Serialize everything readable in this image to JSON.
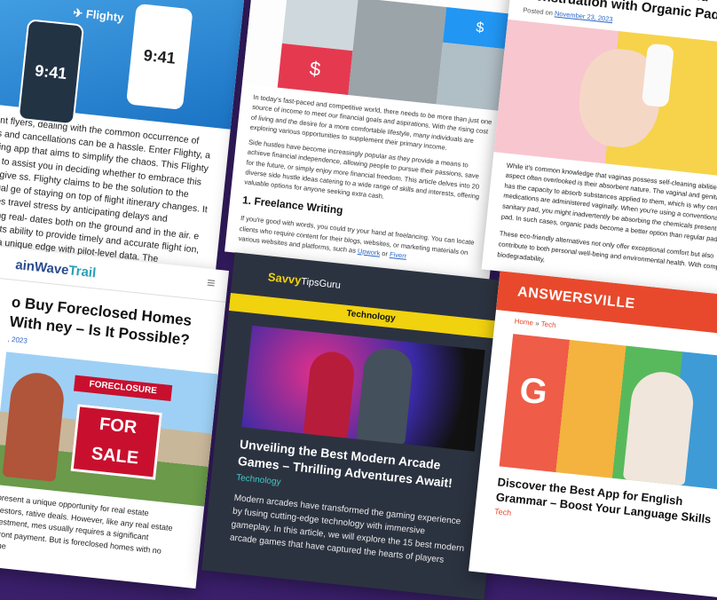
{
  "flighty": {
    "logo": "✈ Flighty",
    "phone_time": "9:41",
    "phone_time_2": "9:41",
    "body": "requent flyers, dealing with the common occurrence of flight s and cancellations can be a hassle. Enter Flighty, a flight- ing app that aims to simplify the chaos. This Flighty review to assist you in deciding whether to embrace this app or give ss. Flighty claims to be the solution to the perpetual ge of staying on top of flight itinerary changes. It promises travel stress by anticipating delays and delivering real- dates both on the ground and in the air. e asserts its ability to provide timely and accurate flight ion, offering a unique edge with pilot-level data. The"
  },
  "side_hustle": {
    "intro": "In today's fast-paced and competitive world, there needs to be more than just one source of income to meet our financial goals and aspirations. With the rising cost of living and the desire for a more comfortable lifestyle, many individuals are exploring various opportunities to supplement their primary income.",
    "para2": "Side hustles have become increasingly popular as they provide a means to achieve financial independence, allowing people to pursue their passions, save for the future, or simply enjoy more financial freedom. This article delves into 20 diverse side hustle ideas catering to a wide range of skills and interests, offering valuable options for anyone seeking extra cash.",
    "heading": "1. Freelance Writing",
    "para3": "If you're good with words, you could try your hand at freelancing. You can locate clients who require content for their blogs, websites, or marketing materials on various websites and platforms, such as",
    "link1": "Upwork",
    "conj": " or ",
    "link2": "Fiverr"
  },
  "feminine": {
    "title": "Better Feminine Hygiene and Menstruation with Organic Pads",
    "posted": "Posted on ",
    "date": "November 23, 2023",
    "body": "While it's common knowledge that vaginas possess self-cleaning abilities, an aspect often overlooked is their absorbent nature. The vaginal and genital skin has the capacity to absorb substances applied to them, which is why certain medications are administered vaginally. When you're using a conventional sanitary pad, you might inadvertently be absorbing the chemicals present in the pad. In such cases, organic pads become a better option than regular pads.",
    "body2": "These eco-friendly alternatives not only offer exceptional comfort but also contribute to both personal well-being and environmental health. With complete biodegradability,"
  },
  "foreclosed": {
    "brand_a": "ainWave",
    "brand_b": "Trail",
    "menu_icon": "≡",
    "title": "o Buy Foreclosed Homes With ney – Is It Possible?",
    "date": ", 2023",
    "sign_top": "FORECLOSURE",
    "sign_main": "FOR SALE",
    "body": "s present a unique opportunity for real estate investors, rative deals. However, like any real estate investment, mes usually requires a significant upfront payment. But is foreclosed homes with no mone"
  },
  "arcade": {
    "brand": "Savvy",
    "brand_sub": "TipsGuru",
    "category": "Technology",
    "title": "Unveiling the Best Modern Arcade Games – Thrilling Adventures Await!",
    "tag": "Technology",
    "body": "Modern arcades have transformed the gaming experience by fusing cutting-edge technology with immersive gameplay. In this article, we will explore the 15 best modern arcade games that have captured the hearts of players"
  },
  "answersville": {
    "brand": "ANSWERSVILLE",
    "bc_home": "Home",
    "bc_sep": " » ",
    "bc_cat": "Tech",
    "title": "Discover the Best App for English Grammar – Boost Your Language Skills",
    "tag": "Tech"
  },
  "colors": {
    "background": "#3a1f6b",
    "arcade_accent": "#f1d20f",
    "answersville_accent": "#e8492c",
    "flighty_blue": "#1b73c4"
  }
}
